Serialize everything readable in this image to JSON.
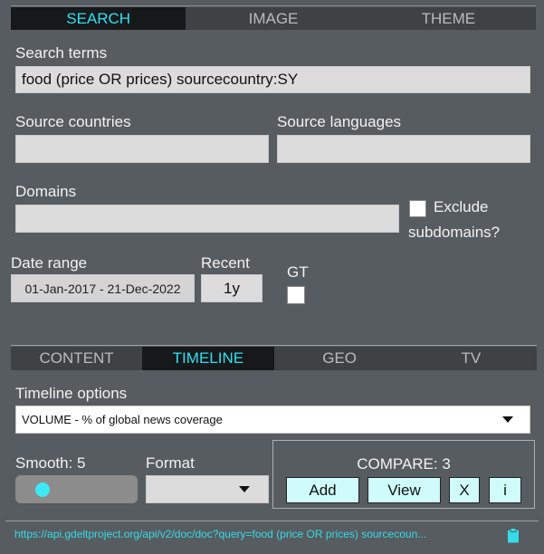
{
  "top_tabs": [
    "SEARCH",
    "IMAGE",
    "THEME"
  ],
  "search": {
    "terms_label": "Search terms",
    "terms_value": "food (price OR prices) sourcecountry:SY",
    "countries_label": "Source countries",
    "languages_label": "Source languages",
    "domains_label": "Domains",
    "exclude_line1": "Exclude",
    "exclude_line2": "subdomains?",
    "date_range_label": "Date range",
    "date_range_value": "01-Jan-2017 - 21-Dec-2022",
    "recent_label": "Recent",
    "recent_value": "1y",
    "gt_label": "GT"
  },
  "bottom_tabs": [
    "CONTENT",
    "TIMELINE",
    "GEO",
    "TV"
  ],
  "timeline": {
    "options_label": "Timeline options",
    "options_value": "VOLUME - % of global news coverage",
    "smooth_label": "Smooth: 5",
    "smooth_value": 5,
    "format_label": "Format",
    "format_value": "",
    "compare_label": "COMPARE: 3",
    "add_label": "Add",
    "view_label": "View",
    "x_label": "X",
    "info_label": "i"
  },
  "footer": {
    "url": "https://api.gdeltproject.org/api/v2/doc/doc?query=food (price OR prices) sourcecoun...",
    "clipboard_icon": "clipboard-icon",
    "link_color": "#35dbe8"
  },
  "colors": {
    "accent": "#2fe1f2",
    "background": "#575c60",
    "button_bg": "#cffbfb"
  }
}
